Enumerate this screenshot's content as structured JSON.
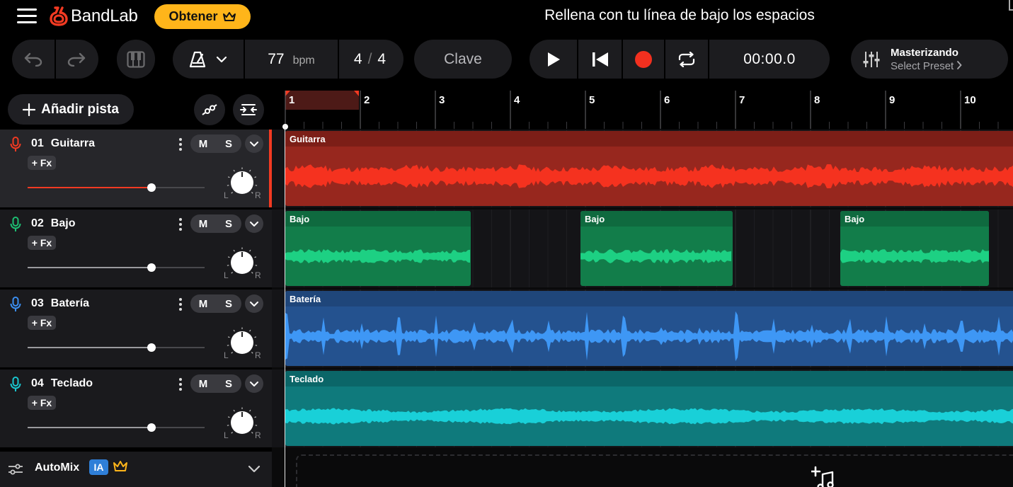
{
  "app": {
    "brand": "BandLab",
    "get_button": "Obtener",
    "header_title": "Rellena con tu línea de bajo los espacios"
  },
  "toolbar": {
    "bpm_value": "77",
    "bpm_unit": "bpm",
    "time_sig_num": "4",
    "time_sig_den": "4",
    "key_label": "Clave",
    "time_display": "00:00.0",
    "mastering_title": "Masterizando",
    "mastering_preset": "Select Preset"
  },
  "panel": {
    "add_track": "Añadir pista",
    "automix_label": "AutoMix",
    "automix_badge": "IA"
  },
  "tracks": [
    {
      "num": "01",
      "name": "Guitarra",
      "color": "#f23a22",
      "volume": 0.7,
      "selected": true,
      "mute": "M",
      "solo": "S",
      "fx": "+ Fx",
      "left": "L",
      "right": "R"
    },
    {
      "num": "02",
      "name": "Bajo",
      "color": "#1dbf73",
      "volume": 0.7,
      "selected": false,
      "mute": "M",
      "solo": "S",
      "fx": "+ Fx",
      "left": "L",
      "right": "R"
    },
    {
      "num": "03",
      "name": "Batería",
      "color": "#3b8ff2",
      "volume": 0.7,
      "selected": false,
      "mute": "M",
      "solo": "S",
      "fx": "+ Fx",
      "left": "L",
      "right": "R"
    },
    {
      "num": "04",
      "name": "Teclado",
      "color": "#19c7d0",
      "volume": 0.7,
      "selected": false,
      "mute": "M",
      "solo": "S",
      "fx": "+ Fx",
      "left": "L",
      "right": "R"
    }
  ],
  "ruler": {
    "bars": [
      "1",
      "2",
      "3",
      "4",
      "5",
      "6",
      "7",
      "8",
      "9",
      "10"
    ]
  },
  "clips": {
    "guitarra": "Guitarra",
    "bajo_1": "Bajo",
    "bajo_2": "Bajo",
    "bajo_3": "Bajo",
    "bateria": "Batería",
    "teclado": "Teclado"
  },
  "colors": {
    "accent": "#ffb51a",
    "record": "#f2301f",
    "guitar_clip": "#97271e",
    "bass_clip": "#127d4a",
    "drums_clip": "#24528f",
    "keys_clip": "#0f7a7c"
  },
  "icons": [
    "menu-icon",
    "bandlab-logo-icon",
    "crown-icon",
    "undo-icon",
    "redo-icon",
    "piano-icon",
    "metronome-icon",
    "chevron-down-icon",
    "play-icon",
    "skip-back-icon",
    "record-icon",
    "loop-icon",
    "mixer-icon",
    "chevron-right-icon",
    "plus-icon",
    "automation-icon",
    "arrange-icon",
    "microphone-icon",
    "more-icon",
    "pan-knob-icon",
    "sliders-icon",
    "add-music-icon"
  ]
}
